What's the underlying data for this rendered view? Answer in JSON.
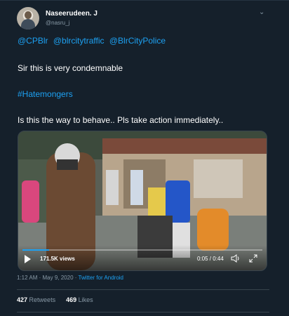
{
  "author": {
    "display_name": "Naseerudeen. J",
    "handle": "@nasru_j",
    "avatar_icon": "avatar-photo",
    "menu_icon": "chevron-down-icon"
  },
  "tweet": {
    "mentions": [
      "@CPBlr",
      "@blrcitytraffic",
      "@BlrCityPolice"
    ],
    "line1": "Sir this is very condemnable",
    "hashtag": "#Hatemongers",
    "line2": "Is this the way to behave.. Pls take action immediately.."
  },
  "video": {
    "views": "171.5K views",
    "time": "0:05 / 0:44",
    "progress": 0.11,
    "play_icon": "play-icon",
    "volume_icon": "volume-icon",
    "fullscreen_icon": "fullscreen-icon"
  },
  "meta": {
    "time": "1:12 AM",
    "date": "May 9, 2020",
    "separator": "·",
    "source": "Twitter for Android"
  },
  "stats": {
    "retweets_count": "427",
    "retweets_label": "Retweets",
    "likes_count": "469",
    "likes_label": "Likes"
  },
  "colors": {
    "background": "#15202b",
    "link": "#1da1f2",
    "muted": "#8899a6",
    "border": "#38444d"
  }
}
